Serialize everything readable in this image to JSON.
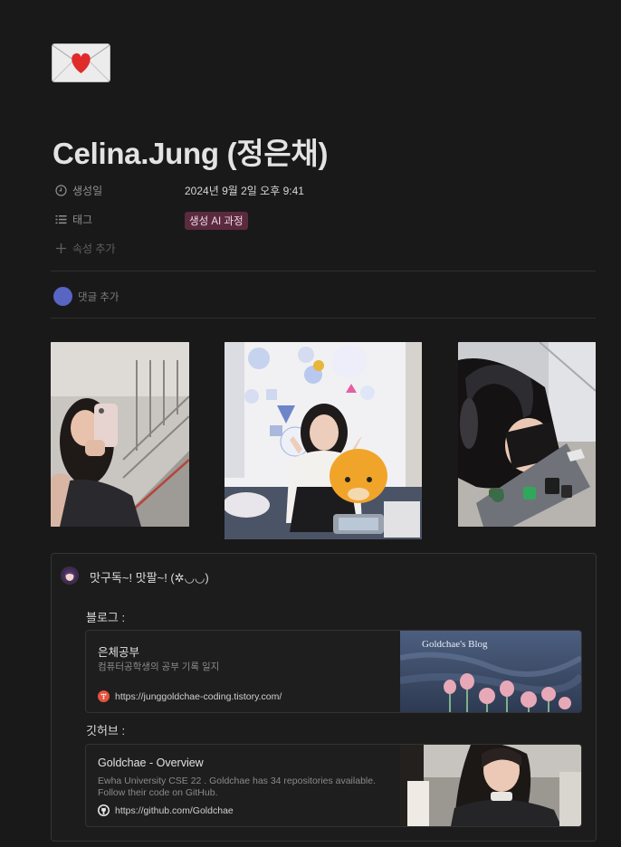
{
  "page": {
    "icon": "envelope-heart-icon",
    "title": "Celina.Jung (정은채)"
  },
  "properties": {
    "created": {
      "label": "생성일",
      "icon": "clock-icon",
      "value": "2024년 9월 2일 오후 9:41"
    },
    "tags": {
      "label": "태그",
      "icon": "list-icon",
      "value": "생성 AI 과정",
      "color": "#5a2a3e"
    },
    "add_property": {
      "label": "속성 추가",
      "icon": "plus-icon"
    }
  },
  "comment": {
    "placeholder": "댓글 추가",
    "avatar_color": "#5865c3"
  },
  "gallery": {
    "photos": [
      "photo-stairs-selfie",
      "photo-kakao-friends",
      "photo-headphones-laptop"
    ]
  },
  "callout": {
    "icon": "avatar-emoji-icon",
    "text": "맛구독~! 맛팔~! (✲◡◡)",
    "blog_label": "블로그 :",
    "github_label": "깃허브 :"
  },
  "bookmarks": [
    {
      "title": "은체공부",
      "description": "컴퓨터공학생의 공부 기록 일지",
      "url": "https://junggoldchae-coding.tistory.com/",
      "favicon": "tistory-icon",
      "thumbnail_text": "Goldchae's Blog"
    },
    {
      "title": "Goldchae - Overview",
      "description": "Ewha University CSE 22 . Goldchae has 34 repositories available. Follow their code on GitHub.",
      "url": "https://github.com/Goldchae",
      "favicon": "github-icon"
    }
  ],
  "colors": {
    "background": "#191919",
    "tag_bg": "#5a2a3e",
    "tistory": "#e5533d"
  }
}
